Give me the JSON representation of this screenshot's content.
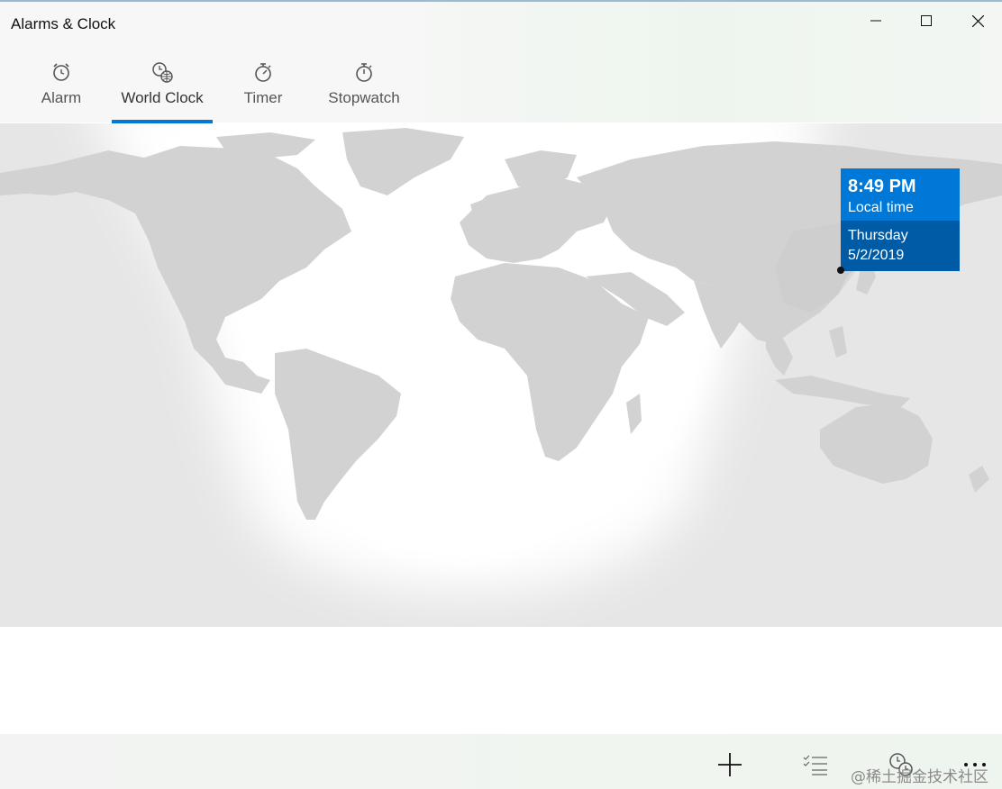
{
  "window": {
    "title": "Alarms & Clock",
    "controls": [
      "minimize-icon",
      "maximize-icon",
      "close-icon"
    ]
  },
  "tabs": [
    {
      "label": "Alarm",
      "icon": "alarm-clock-icon",
      "active": false
    },
    {
      "label": "World Clock",
      "icon": "world-clock-icon",
      "active": true
    },
    {
      "label": "Timer",
      "icon": "timer-icon",
      "active": false
    },
    {
      "label": "Stopwatch",
      "icon": "stopwatch-icon",
      "active": false
    }
  ],
  "map": {
    "tooltip": {
      "time": "8:49 PM",
      "label": "Local time",
      "day": "Thursday",
      "date": "5/2/2019"
    }
  },
  "bottombar": {
    "buttons": [
      "add-icon",
      "select-list-icon",
      "compare-clocks-icon",
      "more-icon"
    ]
  },
  "watermark": "@稀土掘金技术社区",
  "colors": {
    "accent": "#0078d7",
    "tooltip_dark": "#005ba6",
    "night": "#e6e6e6",
    "land": "#d2d2d2"
  }
}
